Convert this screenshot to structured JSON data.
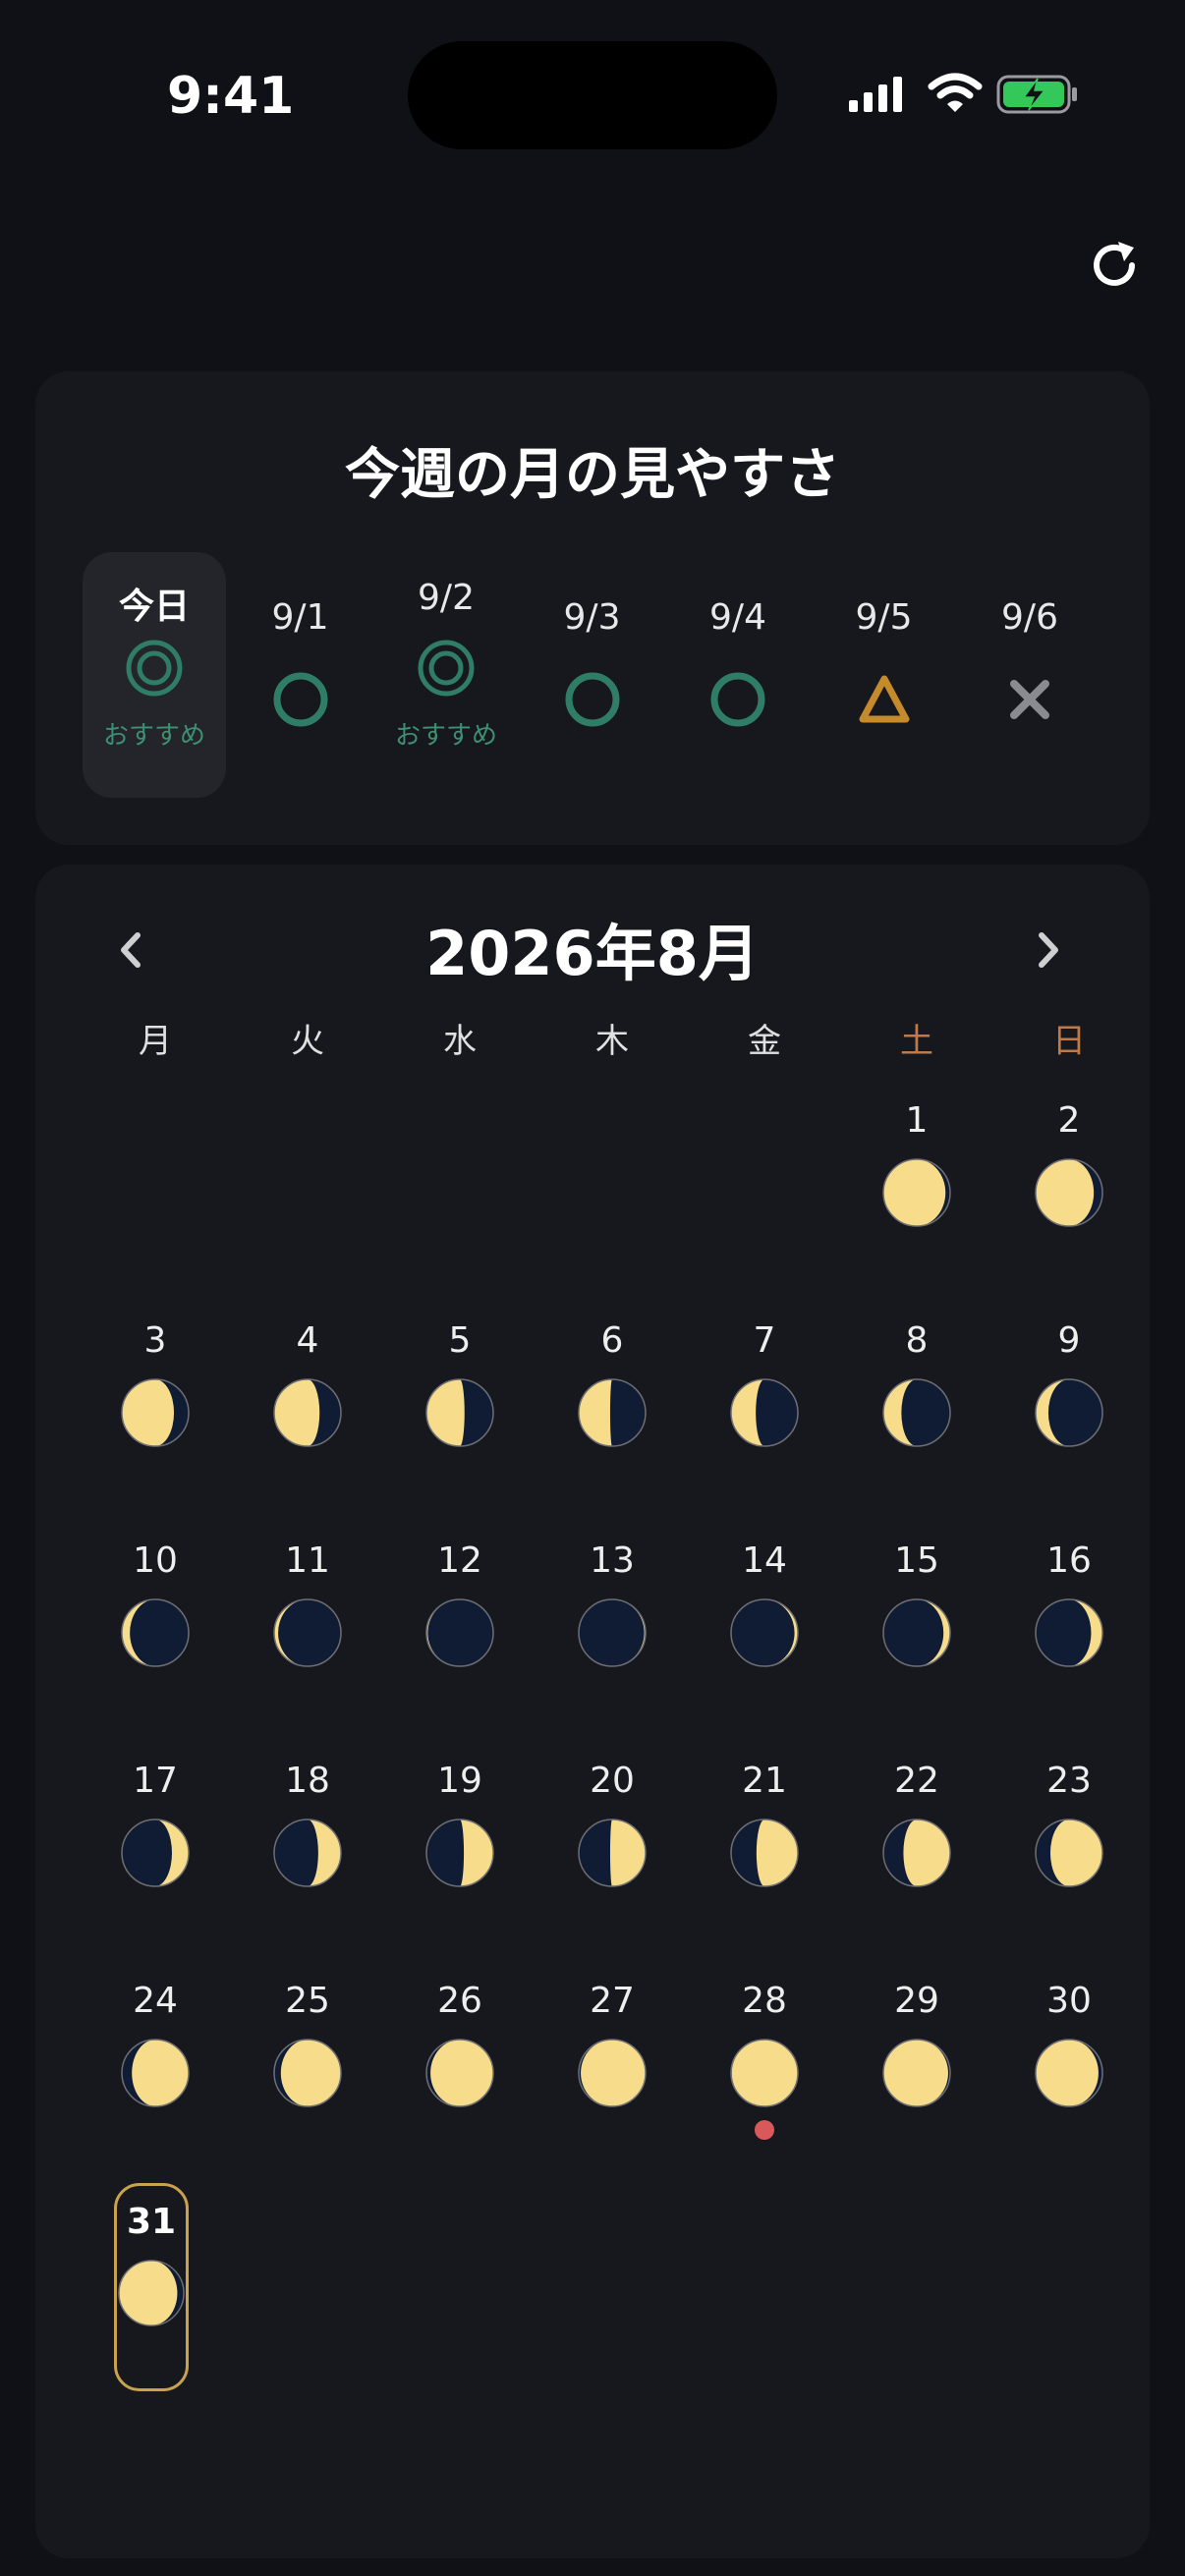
{
  "status_bar": {
    "time": "9:41"
  },
  "colors": {
    "background": "#101116",
    "card": "#16181d",
    "today_highlight": "#23252a",
    "good_green": "#2f7d66",
    "recommend_text": "#3f8f73",
    "fair_orange": "#c58a2a",
    "poor_gray": "#8a8b90",
    "moon_lit": "#f7dc8c",
    "moon_dark": "#0f1c34",
    "weekend": "#c07a45",
    "selected_border": "#c9a24e",
    "event_dot": "#d9595b"
  },
  "header": {
    "refresh_icon": "refresh-icon"
  },
  "week": {
    "title": "今週の月の見やすさ",
    "days": [
      {
        "label": "今日",
        "mark": "double-circle",
        "note": "おすすめ",
        "today": true
      },
      {
        "label": "9/1",
        "mark": "circle",
        "note": ""
      },
      {
        "label": "9/2",
        "mark": "double-circle",
        "note": "おすすめ"
      },
      {
        "label": "9/3",
        "mark": "circle",
        "note": ""
      },
      {
        "label": "9/4",
        "mark": "circle",
        "note": ""
      },
      {
        "label": "9/5",
        "mark": "triangle",
        "note": ""
      },
      {
        "label": "9/6",
        "mark": "cross",
        "note": ""
      }
    ]
  },
  "calendar": {
    "title": "2026年8月",
    "prev_icon": "chevron-left-icon",
    "next_icon": "chevron-right-icon",
    "weekdays": [
      "月",
      "火",
      "水",
      "木",
      "金",
      "土",
      "日"
    ],
    "first_weekday_index": 5,
    "selected_day": 31,
    "event_days": [
      28
    ],
    "days": [
      {
        "day": "1",
        "illum": 0.93,
        "side": "left"
      },
      {
        "day": "2",
        "illum": 0.87,
        "side": "left"
      },
      {
        "day": "3",
        "illum": 0.78,
        "side": "left"
      },
      {
        "day": "4",
        "illum": 0.68,
        "side": "left"
      },
      {
        "day": "5",
        "illum": 0.57,
        "side": "left"
      },
      {
        "day": "6",
        "illum": 0.47,
        "side": "left"
      },
      {
        "day": "7",
        "illum": 0.37,
        "side": "left"
      },
      {
        "day": "8",
        "illum": 0.27,
        "side": "left"
      },
      {
        "day": "9",
        "illum": 0.19,
        "side": "left"
      },
      {
        "day": "10",
        "illum": 0.12,
        "side": "left"
      },
      {
        "day": "11",
        "illum": 0.06,
        "side": "left"
      },
      {
        "day": "12",
        "illum": 0.02,
        "side": "left"
      },
      {
        "day": "13",
        "illum": 0.02,
        "side": "right"
      },
      {
        "day": "14",
        "illum": 0.05,
        "side": "right"
      },
      {
        "day": "15",
        "illum": 0.1,
        "side": "right"
      },
      {
        "day": "16",
        "illum": 0.17,
        "side": "right"
      },
      {
        "day": "17",
        "illum": 0.25,
        "side": "right"
      },
      {
        "day": "18",
        "illum": 0.34,
        "side": "right"
      },
      {
        "day": "19",
        "illum": 0.44,
        "side": "right"
      },
      {
        "day": "20",
        "illum": 0.53,
        "side": "right"
      },
      {
        "day": "21",
        "illum": 0.62,
        "side": "right"
      },
      {
        "day": "22",
        "illum": 0.7,
        "side": "right"
      },
      {
        "day": "23",
        "illum": 0.78,
        "side": "right"
      },
      {
        "day": "24",
        "illum": 0.85,
        "side": "right"
      },
      {
        "day": "25",
        "illum": 0.9,
        "side": "right"
      },
      {
        "day": "26",
        "illum": 0.94,
        "side": "right"
      },
      {
        "day": "27",
        "illum": 0.97,
        "side": "right"
      },
      {
        "day": "28",
        "illum": 0.99,
        "side": "right"
      },
      {
        "day": "29",
        "illum": 0.97,
        "side": "left"
      },
      {
        "day": "30",
        "illum": 0.94,
        "side": "left"
      },
      {
        "day": "31",
        "illum": 0.9,
        "side": "left"
      }
    ]
  }
}
